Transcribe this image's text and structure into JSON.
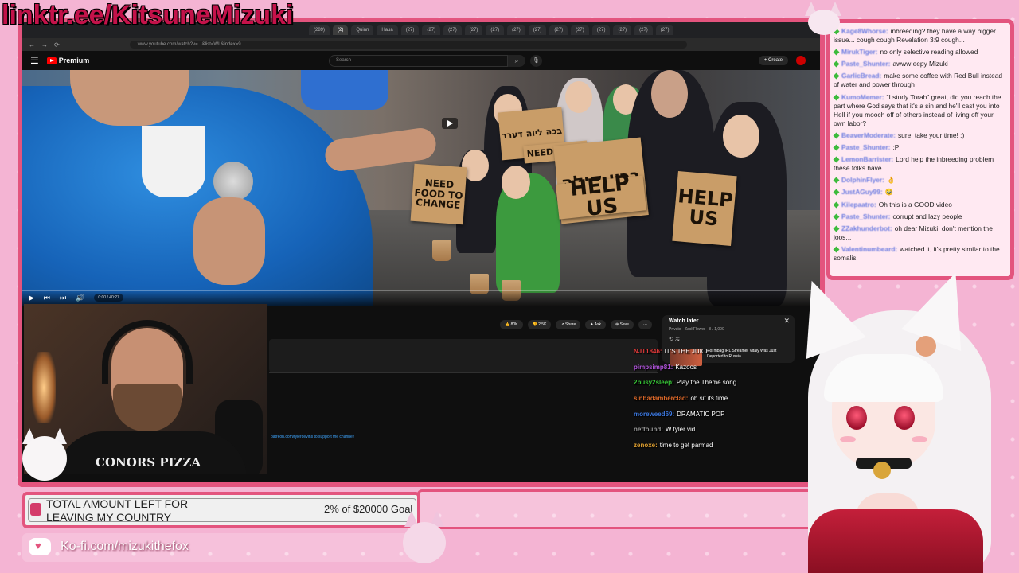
{
  "overlay": {
    "link_banner": "linktr.ee/KitsuneMizuki",
    "kofi": "Ko-fi.com/mizukithefox"
  },
  "goal": {
    "title": "TOTAL AMOUNT LEFT FOR LEAVING MY COUNTRY",
    "progress": "2% of $20000 Goal"
  },
  "browser": {
    "tabs": [
      "(289)",
      "(2)",
      "Quinn",
      "Haua",
      "(27)",
      "(27)",
      "(27)",
      "(27)",
      "(27)",
      "(27)",
      "(27)",
      "(27)",
      "(27)",
      "(27)",
      "(27)",
      "(27)",
      "(27)"
    ],
    "url": "www.youtube.com/watch?v=...&list=WL&index=9"
  },
  "youtube": {
    "menu_icon": "☰",
    "logo_text": "Premium",
    "search_placeholder": "Search",
    "search_icon": "⌕",
    "mic_icon": "🎙",
    "create_label": "+ Create",
    "time": "0:00 / 40:27",
    "actions": {
      "like": "👍 80K",
      "dislike": "👎 2.5K",
      "share": "↗ Share",
      "ask": "✦ Ask",
      "save": "⊕ Save",
      "more": "⋯"
    },
    "patreon_link": "patreon.com/tylerdevins to support the channel!",
    "watch_later": {
      "title": "Watch later",
      "sub": "Private · ZackFlower · 8 / 1,000",
      "close": "✕",
      "icons": "⟲  ⤮",
      "video_title": "Scumbag IRL Streamer Vitaly Was Just Deported to Russia..."
    }
  },
  "signs": {
    "hebrew_top": "בכה ליוה דערר",
    "need_food_1": "NEED FOOD",
    "need_food_2": "NEED FOOD TO CHANGE",
    "hebrew_big": "בכין קולה",
    "help_us_1": "HELP US",
    "help_us_2": "HELP US"
  },
  "webcam": {
    "shirt_text": "CONORS PIZZA"
  },
  "inner_chat": [
    {
      "user": "NJT1846:",
      "text": "IT'S THE JUICE!!",
      "color": "#e03a3a"
    },
    {
      "user": "pimpsimp81:",
      "text": "Kazoos",
      "color": "#b455e0"
    },
    {
      "user": "2busy2sleep:",
      "text": "Play the Theme song",
      "color": "#37c837"
    },
    {
      "user": "sinbadamberclad:",
      "text": "oh sit its time",
      "color": "#e06a2a"
    },
    {
      "user": "moreweed69:",
      "text": "DRAMATIC POP",
      "color": "#3c78e0"
    },
    {
      "user": "netfound:",
      "text": "W tyler vid",
      "color": "#999999"
    },
    {
      "user": "zenoxe:",
      "text": "time to get parmad",
      "color": "#e0a030"
    }
  ],
  "chat": [
    {
      "user": "Kage8Whorse:",
      "text": "inbreeding? they have a way bigger issue... cough cough Revelation 3:9 cough...",
      "color": "#6b7be0"
    },
    {
      "user": "MirukTiger:",
      "text": "no only selective reading allowed",
      "color": "#6b7be0"
    },
    {
      "user": "Paste_Shunter:",
      "text": "awww eepy Mizuki",
      "color": "#6b7be0"
    },
    {
      "user": "GarlicBread:",
      "text": "make some coffee with Red Bull instead of water and power through",
      "color": "#6b7be0"
    },
    {
      "user": "KumoMemer:",
      "text": "\"I study Torah\" great, did you reach the part where God says that it's a sin and he'll cast you into Hell if you mooch off of others instead of living off your own labor?",
      "color": "#6b7be0"
    },
    {
      "user": "BeaverModerate:",
      "text": "sure! take your time! :)",
      "color": "#6b7be0"
    },
    {
      "user": "Paste_Shunter:",
      "text": ":P",
      "color": "#6b7be0"
    },
    {
      "user": "LemonBarrister:",
      "text": "Lord help the inbreeding problem these folks have",
      "color": "#6b7be0"
    },
    {
      "user": "DolphinFlyer:",
      "text": "👌",
      "color": "#6b7be0"
    },
    {
      "user": "JustAGuy99:",
      "text": "🥹",
      "color": "#6b7be0"
    },
    {
      "user": "Kilepaatro:",
      "text": "Oh this is a GOOD video",
      "color": "#6b7be0"
    },
    {
      "user": "Paste_Shunter:",
      "text": "corrupt and lazy people",
      "color": "#6b7be0"
    },
    {
      "user": "ZZakhunderbot:",
      "text": "oh dear Mizuki, don't mention the joos...",
      "color": "#6b7be0"
    },
    {
      "user": "Valentinumbeard:",
      "text": "watched it, it's pretty similar to the somalis",
      "color": "#6b7be0"
    }
  ],
  "colors": {
    "frame_pink": "#e3547e",
    "banner_red": "#c4124a",
    "background_pink": "#f4b4d3",
    "youtube_red": "#ff0000"
  }
}
